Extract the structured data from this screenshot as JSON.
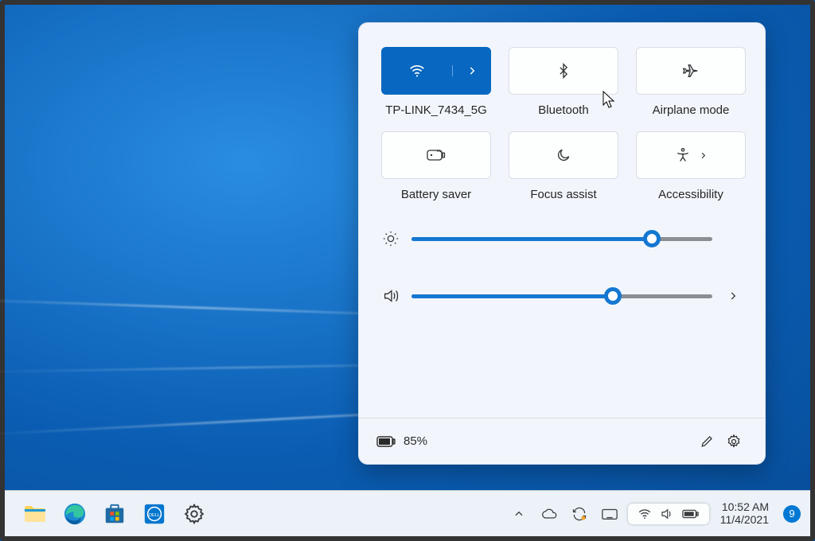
{
  "qs": {
    "tiles": {
      "wifi": "TP-LINK_7434_5G",
      "bluetooth": "Bluetooth",
      "airplane": "Airplane mode",
      "battery_saver": "Battery saver",
      "focus": "Focus assist",
      "accessibility": "Accessibility"
    },
    "brightness_percent": 80,
    "volume_percent": 67,
    "battery_text": "85%"
  },
  "taskbar": {
    "time": "10:52 AM",
    "date": "11/4/2021",
    "notification_count": "9"
  }
}
